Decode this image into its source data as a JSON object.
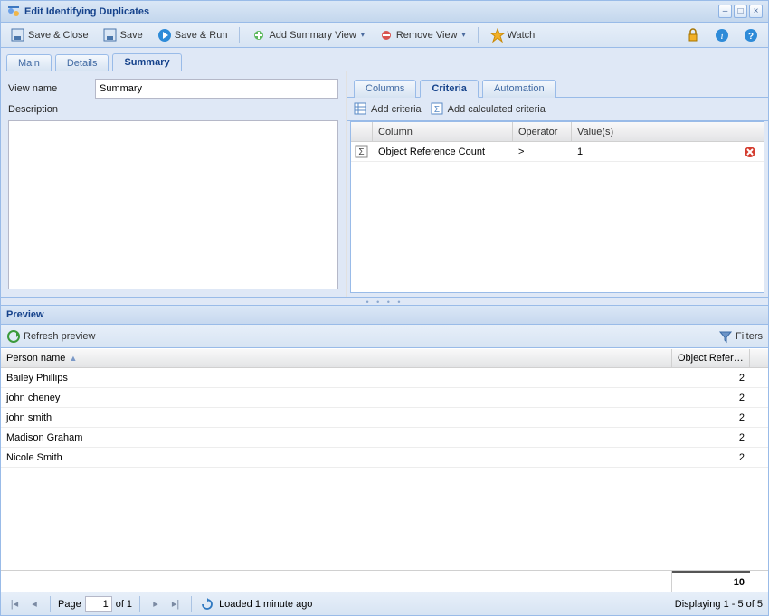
{
  "window": {
    "title": "Edit Identifying Duplicates"
  },
  "toolbar": {
    "save_close": "Save & Close",
    "save": "Save",
    "save_run": "Save & Run",
    "add_summary_view": "Add Summary View",
    "remove_view": "Remove View",
    "watch": "Watch"
  },
  "tabs": {
    "main": "Main",
    "details": "Details",
    "summary": "Summary"
  },
  "form": {
    "view_name_label": "View name",
    "view_name_value": "Summary",
    "description_label": "Description",
    "description_value": ""
  },
  "subtabs": {
    "columns": "Columns",
    "criteria": "Criteria",
    "automation": "Automation"
  },
  "criteria_toolbar": {
    "add": "Add criteria",
    "add_calc": "Add calculated criteria"
  },
  "criteria_grid": {
    "headers": {
      "column": "Column",
      "operator": "Operator",
      "values": "Value(s)"
    },
    "rows": [
      {
        "column": "Object Reference Count",
        "operator": ">",
        "value": "1"
      }
    ]
  },
  "preview": {
    "panel_title": "Preview",
    "refresh": "Refresh preview",
    "filters": "Filters",
    "headers": {
      "person_name": "Person name",
      "object_ref": "Object Refer…"
    },
    "rows": [
      {
        "name": "Bailey Phillips",
        "ref": "2"
      },
      {
        "name": "john cheney",
        "ref": "2"
      },
      {
        "name": "john smith",
        "ref": "2"
      },
      {
        "name": "Madison Graham",
        "ref": "2"
      },
      {
        "name": "Nicole Smith",
        "ref": "2"
      }
    ],
    "total_ref": "10"
  },
  "paging": {
    "page_label": "Page",
    "page_current": "1",
    "page_of": "of 1",
    "loaded": "Loaded 1 minute ago",
    "displaying": "Displaying 1 - 5 of 5"
  }
}
